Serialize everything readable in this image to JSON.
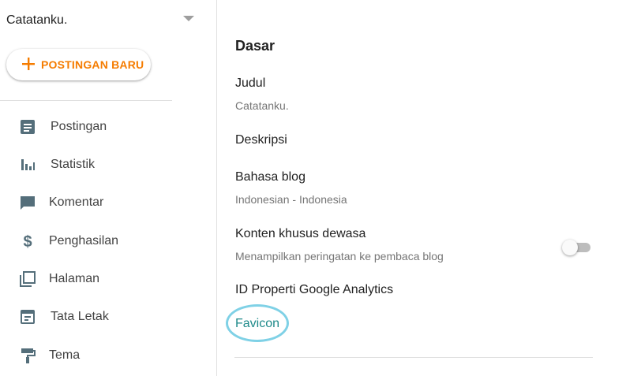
{
  "sidebar": {
    "blog_name": "Catatanku.",
    "new_post_label": "POSTINGAN BARU",
    "items": [
      {
        "label": "Postingan",
        "icon": "posts-icon"
      },
      {
        "label": "Statistik",
        "icon": "stats-icon"
      },
      {
        "label": "Komentar",
        "icon": "comment-icon"
      },
      {
        "label": "Penghasilan",
        "icon": "dollar-icon"
      },
      {
        "label": "Halaman",
        "icon": "pages-icon"
      },
      {
        "label": "Tata Letak",
        "icon": "layout-icon"
      },
      {
        "label": "Tema",
        "icon": "paint-roller-icon"
      }
    ]
  },
  "main": {
    "section_title": "Dasar",
    "title_label": "Judul",
    "title_value": "Catatanku.",
    "description_label": "Deskripsi",
    "language_label": "Bahasa blog",
    "language_value": "Indonesian - Indonesia",
    "adult_label": "Konten khusus dewasa",
    "adult_desc": "Menampilkan peringatan ke pembaca blog",
    "adult_enabled": false,
    "analytics_label": "ID Properti Google Analytics",
    "favicon_label": "Favicon"
  },
  "colors": {
    "accent_orange": "#f57c00",
    "link_teal": "#1f8a8a",
    "icon_gray": "#546e7a",
    "highlight_ring": "#7fd1e6"
  }
}
